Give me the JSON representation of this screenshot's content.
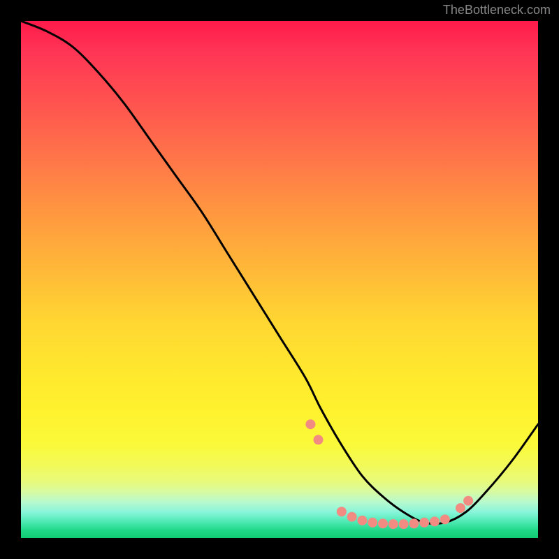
{
  "attribution": "TheBottleneck.com",
  "chart_data": {
    "type": "line",
    "title": "",
    "xlabel": "",
    "ylabel": "",
    "x_range": [
      0,
      100
    ],
    "y_range": [
      0,
      100
    ],
    "series": [
      {
        "name": "curve",
        "x": [
          0,
          5,
          10,
          15,
          20,
          25,
          30,
          35,
          40,
          45,
          50,
          55,
          58,
          62,
          66,
          70,
          74,
          78,
          82,
          86,
          90,
          95,
          100
        ],
        "y": [
          100,
          98,
          95,
          90,
          84,
          77,
          70,
          63,
          55,
          47,
          39,
          31,
          25,
          18,
          12,
          8,
          5,
          3,
          3,
          5,
          9,
          15,
          22
        ]
      }
    ],
    "markers": {
      "x": [
        56,
        57.5,
        62,
        64,
        66,
        68,
        70,
        72,
        74,
        76,
        78,
        80,
        82,
        85,
        86.5
      ],
      "y": [
        22,
        19,
        5.1,
        4.1,
        3.4,
        3.0,
        2.8,
        2.7,
        2.7,
        2.8,
        3.0,
        3.2,
        3.6,
        5.8,
        7.2
      ],
      "color": "#f28b82",
      "radius": 7
    },
    "background_gradient": {
      "top": "#ff1a4a",
      "mid": "#ffe82e",
      "bottom": "#10cc70"
    }
  }
}
